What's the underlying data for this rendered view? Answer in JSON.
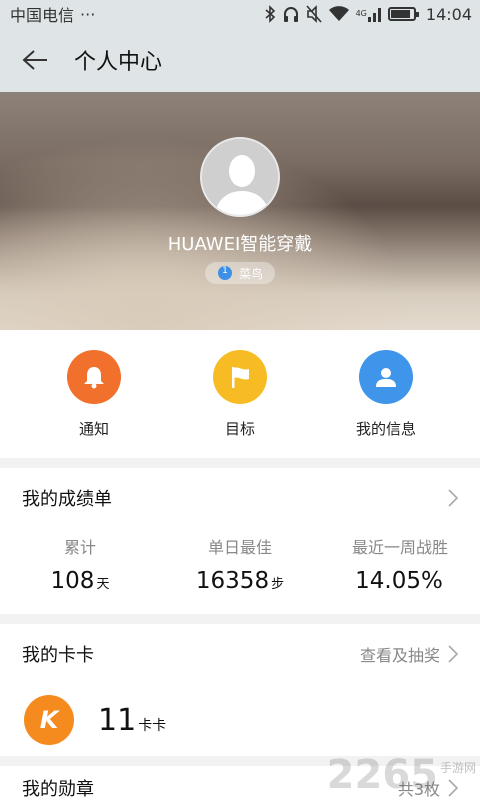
{
  "status_bar": {
    "carrier": "中国电信",
    "more": "···",
    "network": "4G",
    "time": "14:04",
    "battery_level": 0.85,
    "icons": [
      "bluetooth-icon",
      "headphones-icon",
      "mute-icon",
      "wifi-icon",
      "signal-icon",
      "battery-icon"
    ]
  },
  "header": {
    "title": "个人中心",
    "background": "#dfe5e6"
  },
  "profile": {
    "username": "HUAWEI智能穿戴",
    "level_number": "1",
    "level_name": "菜鸟"
  },
  "quick_actions": [
    {
      "label": "通知",
      "icon": "bell-icon",
      "color": "#f0702c"
    },
    {
      "label": "目标",
      "icon": "flag-icon",
      "color": "#f7bb23"
    },
    {
      "label": "我的信息",
      "icon": "person-icon",
      "color": "#3f95ea"
    }
  ],
  "scorecard": {
    "title": "我的成绩单",
    "stats": [
      {
        "label": "累计",
        "value": "108",
        "unit": "天"
      },
      {
        "label": "单日最佳",
        "value": "16358",
        "unit": "步"
      },
      {
        "label": "最近一周战胜",
        "value": "14.05%",
        "unit": ""
      }
    ]
  },
  "kaka": {
    "title": "我的卡卡",
    "link": "查看及抽奖",
    "icon_letter": "K",
    "count": "11",
    "unit": "卡卡"
  },
  "medals": {
    "title": "我的勋章",
    "count_text": "共3枚"
  },
  "watermark": {
    "number": "2265",
    "suffix": "手游网"
  }
}
